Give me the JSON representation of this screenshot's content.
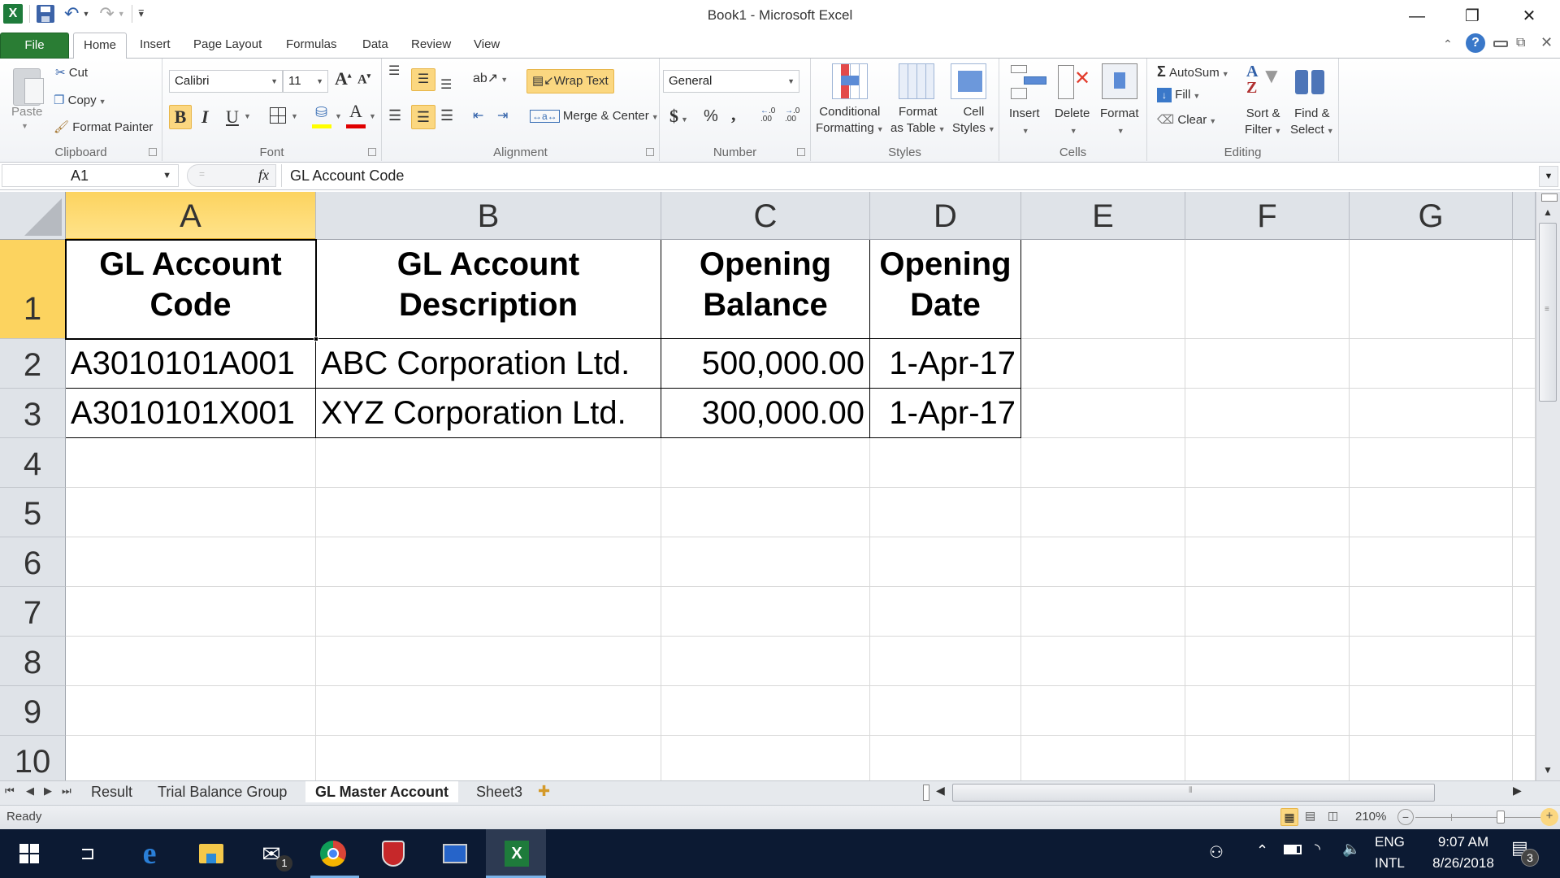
{
  "window": {
    "title": "Book1 - Microsoft Excel",
    "controls": {
      "minimize": "—",
      "restore": "❐",
      "close": "✕"
    }
  },
  "ribbon_tabs": [
    "File",
    "Home",
    "Insert",
    "Page Layout",
    "Formulas",
    "Data",
    "Review",
    "View"
  ],
  "active_tab": "Home",
  "clipboard": {
    "paste": "Paste",
    "cut": "Cut",
    "copy": "Copy",
    "format_painter": "Format Painter",
    "label": "Clipboard"
  },
  "font": {
    "name": "Calibri",
    "size": "11",
    "bold": "B",
    "italic": "I",
    "underline": "U",
    "grow": "A",
    "shrink": "A",
    "font_color_glyph": "A",
    "label": "Font",
    "fill_color": "#ffff00",
    "font_color": "#e00000"
  },
  "alignment": {
    "wrap_text": "Wrap Text",
    "merge_center": "Merge & Center",
    "label": "Alignment"
  },
  "number": {
    "format": "General",
    "currency": "$",
    "percent": "%",
    "comma": ",",
    "inc_decimal": "←.0 .00",
    "dec_decimal": "→.0 .00",
    "label": "Number"
  },
  "styles": {
    "conditional_formatting": [
      "Conditional",
      "Formatting"
    ],
    "format_as_table": [
      "Format",
      "as Table"
    ],
    "cell_styles": [
      "Cell",
      "Styles"
    ],
    "label": "Styles"
  },
  "cells": {
    "insert": "Insert",
    "delete": "Delete",
    "format": "Format",
    "label": "Cells"
  },
  "editing": {
    "autosum": "AutoSum",
    "fill": "Fill",
    "clear": "Clear",
    "sort_filter": [
      "Sort &",
      "Filter"
    ],
    "find_select": [
      "Find &",
      "Select"
    ],
    "label": "Editing"
  },
  "formula_bar": {
    "name_box": "A1",
    "fx": "fx",
    "value": "GL Account Code"
  },
  "sheet": {
    "columns": [
      "A",
      "B",
      "C",
      "D",
      "E",
      "F",
      "G"
    ],
    "selected_column": "A",
    "rows": [
      "1",
      "2",
      "3",
      "4",
      "5",
      "6",
      "7",
      "8",
      "9",
      "10"
    ],
    "selected_row": "1",
    "header": [
      "GL Account Code",
      "GL Account Description",
      "Opening Balance",
      "Opening Date"
    ],
    "header_lines": [
      [
        "GL Account",
        "Code"
      ],
      [
        "GL Account",
        "Description"
      ],
      [
        "Opening",
        "Balance"
      ],
      [
        "Opening",
        "Date"
      ]
    ],
    "data": [
      [
        "A3010101A001",
        "ABC Corporation Ltd.",
        "500,000.00",
        "1-Apr-17"
      ],
      [
        "A3010101X001",
        "XYZ Corporation Ltd.",
        "300,000.00",
        "1-Apr-17"
      ]
    ]
  },
  "sheet_tabs": [
    "Result",
    "Trial Balance Group",
    "GL Master Account",
    "Sheet3"
  ],
  "active_sheet": "GL Master Account",
  "status": {
    "ready": "Ready",
    "zoom": "210%",
    "zoom_percent": 210
  },
  "taskbar": {
    "mail_badge": "1",
    "lang_top": "ENG",
    "lang_bottom": "INTL",
    "time": "9:07 AM",
    "date": "8/26/2018",
    "notif_badge": "3"
  }
}
